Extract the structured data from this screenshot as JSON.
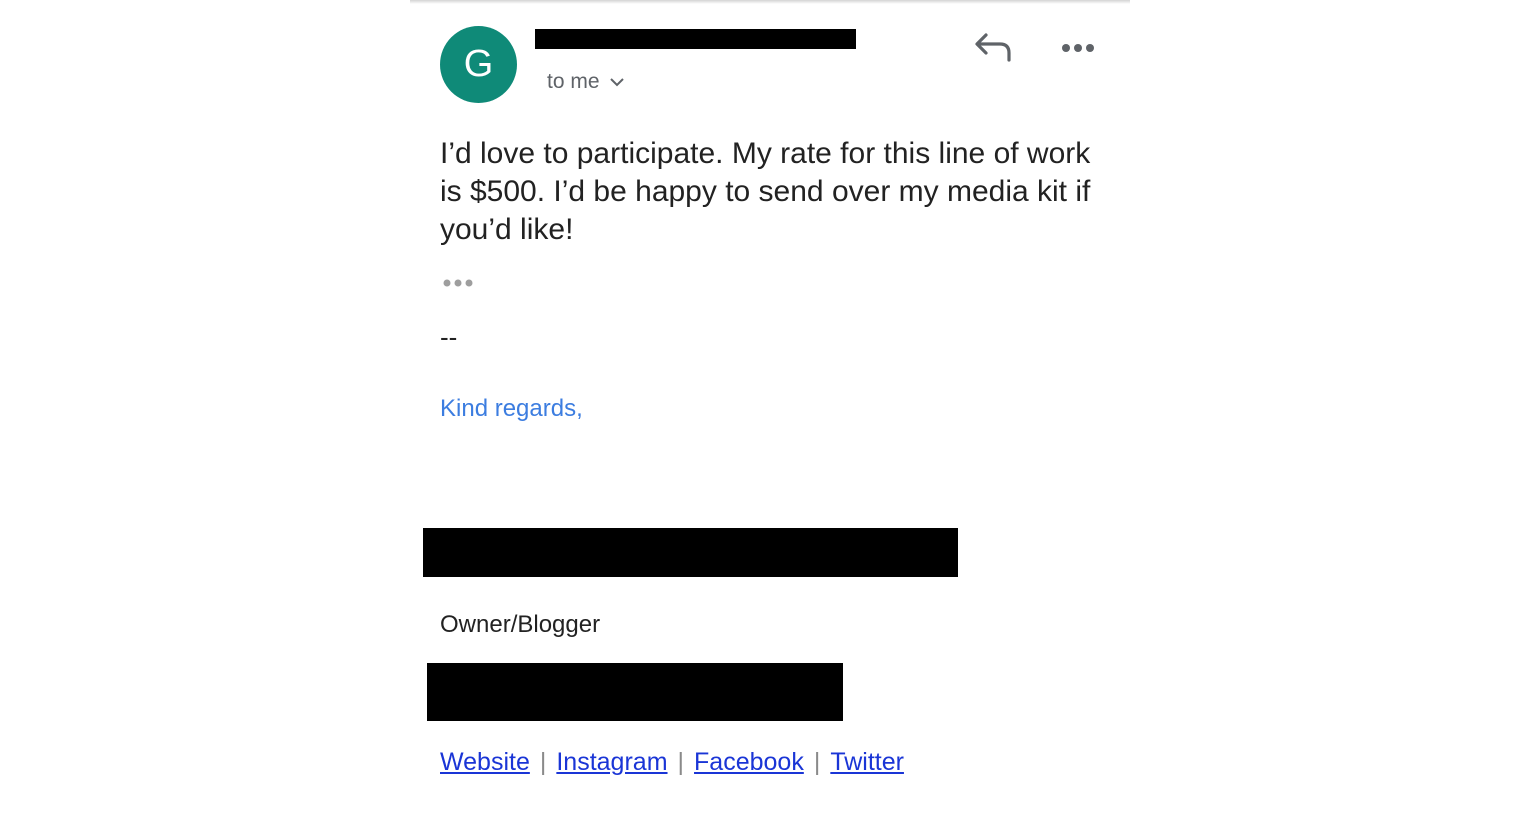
{
  "header": {
    "avatar_letter": "G",
    "recipient_label": "to me",
    "reply_icon": "reply-icon",
    "more_icon": "more-horiz-icon",
    "avatar_color": "#0f8a78"
  },
  "message": {
    "body": "I’d love to participate. My rate for this line of work is $500. I’d be happy to send over my media kit if you’d like!",
    "signature_separator": "--",
    "closing": "Kind regards,",
    "title": "Owner/Blogger",
    "links": [
      "Website",
      "Instagram",
      "Facebook",
      "Twitter"
    ],
    "link_separator": "|",
    "closing_color": "#3c7de0",
    "link_color": "#1a35d6"
  }
}
